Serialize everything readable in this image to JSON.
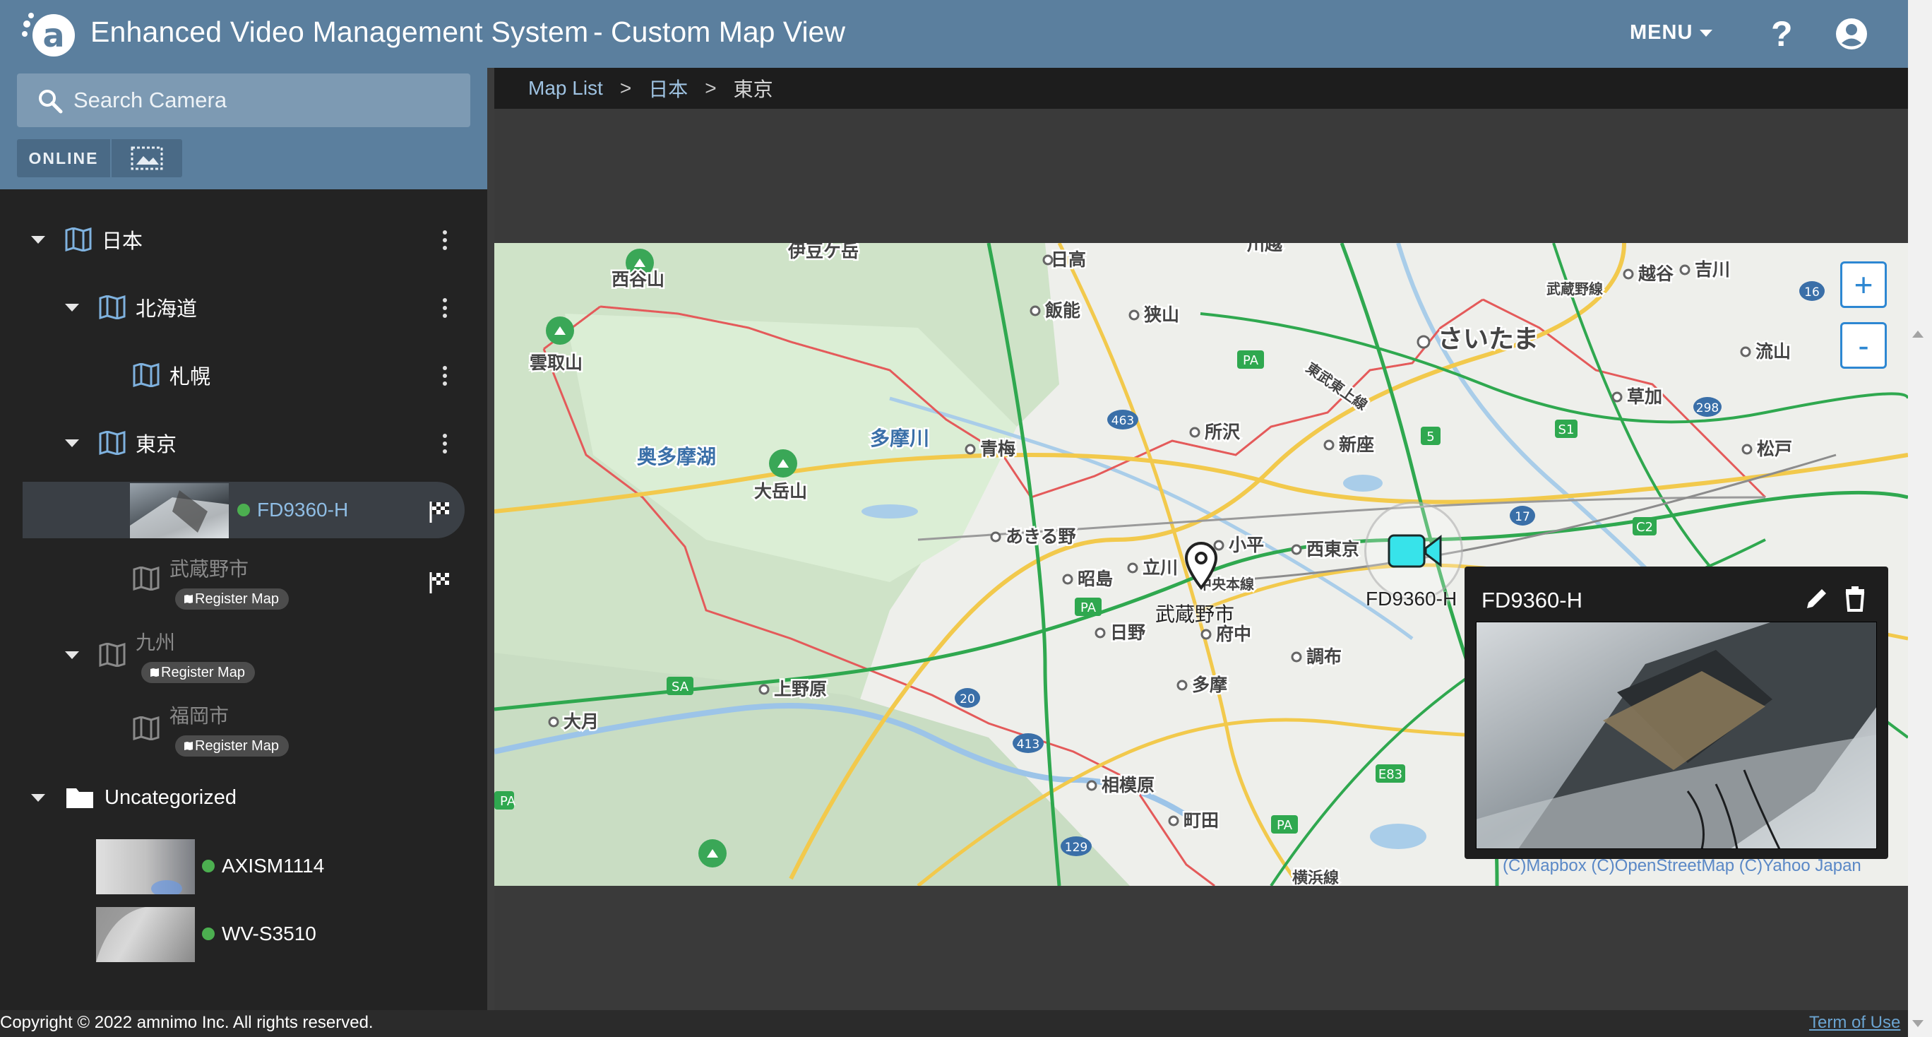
{
  "header": {
    "title": "Enhanced Video Management System",
    "subtitle": "- Custom Map View",
    "menu_label": "MENU",
    "help_label": "?",
    "colors": {
      "header_bg": "#5b7f9e",
      "accent": "#00bcd4"
    }
  },
  "search": {
    "placeholder": "Search Camera"
  },
  "filters": {
    "online_label": "ONLINE",
    "map_filter_icon": "map-outline-icon"
  },
  "tree": {
    "japan": {
      "label": "日本"
    },
    "hokkaido": {
      "label": "北海道"
    },
    "sapporo": {
      "label": "札幌"
    },
    "tokyo": {
      "label": "東京"
    },
    "fd_camera": {
      "label": "FD9360-H",
      "status": "online"
    },
    "musashino": {
      "label": "武蔵野市",
      "register_label": "Register Map"
    },
    "kyushu": {
      "label": "九州",
      "register_label": "Register Map"
    },
    "fukuoka": {
      "label": "福岡市",
      "register_label": "Register Map"
    },
    "uncategorized": {
      "label": "Uncategorized",
      "cameras": [
        {
          "label": "AXISM1114",
          "status": "online"
        },
        {
          "label": "WV-S3510",
          "status": "online"
        }
      ]
    }
  },
  "breadcrumb": {
    "items": [
      "Map List",
      "日本",
      "東京"
    ],
    "separator": ">"
  },
  "map": {
    "zoom_in": "+",
    "zoom_out": "-",
    "marker_label": "武蔵野市",
    "camera_label": "FD9360-H",
    "attribution": "(C)Mapbox (C)OpenStreetMap (C)Yahoo Japan",
    "places": {
      "p1": "伊豆ケ岳",
      "p2": "日高",
      "p3": "川越",
      "p4": "越谷",
      "p5": "吉川",
      "p6": "武蔵野線",
      "p7": "西谷山",
      "p8": "飯能",
      "p9": "狭山",
      "p10": "さいたま",
      "p11": "雲取山",
      "p12": "草加",
      "p13": "流山",
      "p14": "所沢",
      "p15": "新座",
      "p16": "多摩川",
      "p17": "青梅",
      "p18": "奥多摩湖",
      "p19": "大岳山",
      "p20": "松戸",
      "p21": "あきる野",
      "p22": "小平",
      "p23": "西東京",
      "p24": "立川",
      "p25": "昭島",
      "p26": "中央本線",
      "p27": "日野",
      "p28": "府中",
      "p29": "調布",
      "p30": "多摩",
      "p31": "上野原",
      "p32": "大月",
      "p33": "相模原",
      "p34": "町田",
      "p35": "横浜線",
      "p36": "東武東上線"
    }
  },
  "popup": {
    "title": "FD9360-H"
  },
  "footer": {
    "copyright": "Copyright © 2022 amnimo Inc. All rights reserved.",
    "terms": "Term of Use"
  }
}
